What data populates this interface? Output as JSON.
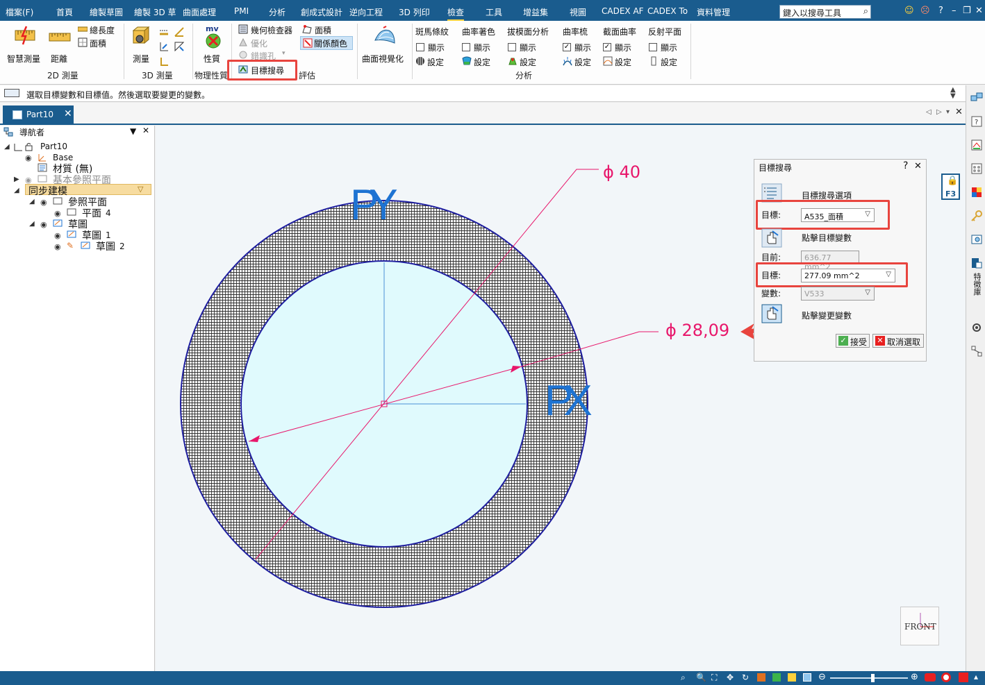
{
  "menu": {
    "items": [
      "檔案(F)",
      "首頁",
      "繪製草圖",
      "繪製 3D 草",
      "曲面處理",
      "PMI",
      "分析",
      "創成式設計",
      "逆向工程",
      "3D 列印",
      "檢查",
      "工具",
      "增益集",
      "視圖",
      "CADEX AF",
      "CADEX To",
      "資料管理"
    ],
    "active_index": 10,
    "search_placeholder": "鍵入以搜尋工具",
    "window_controls": [
      "?",
      "–",
      "❐",
      "✕"
    ]
  },
  "ribbon": {
    "measure2d": {
      "smart": "智慧測量",
      "distance": "距離",
      "total_length": "總長度",
      "area": "面積",
      "group": "2D 測量"
    },
    "measure3d": {
      "measure": "測量",
      "group": "3D 測量"
    },
    "physical": {
      "mv": "mv",
      "props": "性質",
      "group": "物理性質"
    },
    "evaluate": {
      "geom_checker": "幾何檢查器",
      "optimize": "優化",
      "error_id": "錯識孔",
      "area": "面積",
      "relation_color": "關係顏色",
      "goal_seek": "目標搜尋",
      "group_suffix": "評估"
    },
    "surface_vis": {
      "label": "曲面視覺化"
    },
    "analysis": {
      "zebra": "斑馬條紋",
      "curvature_shade": "曲率著色",
      "draft": "拔模面分析",
      "curvature_comb": "曲率梳",
      "section_curv": "截面曲率",
      "reflective": "反射平面",
      "show": "顯示",
      "settings": "設定",
      "group": "分析"
    }
  },
  "prompt": {
    "text": "選取目標變數和目標值。然後選取要變更的變數。"
  },
  "tab": {
    "name": "Part10",
    "close": "✕"
  },
  "navigator": {
    "title": "導航者",
    "items": {
      "part": "Part10",
      "base": "Base",
      "material": "材質 (無)",
      "base_planes": "基本參照平面",
      "sync": "同步建模",
      "ref_planes": "參照平面",
      "plane": "平面",
      "plane_num": "4",
      "sketch_group": "草圖",
      "sketch": "草圖",
      "sketch1_num": "1",
      "sketch2_num": "2"
    }
  },
  "canvas": {
    "dim_outer": "ϕ 40",
    "dim_inner": "ϕ 28,09",
    "axis_y": "PY",
    "axis_x": "PX",
    "view": "FRONT"
  },
  "dialog": {
    "title": "目標搜尋",
    "help": "?",
    "close": "✕",
    "options": "目標搜尋選項",
    "target_label": "目標:",
    "target_value": "A535_面積",
    "click_target": "點擊目標變數",
    "current_label": "目前:",
    "current_value": "636.77 mm^2",
    "goal_label": "目標:",
    "goal_value": "277.09 mm^2",
    "variable_label": "變數:",
    "variable_value": "V533",
    "click_change": "點擊變更變數",
    "accept": "接受",
    "cancel": "取消選取"
  },
  "rail": {
    "vertical_label": "特徵庫",
    "f3": "F3"
  },
  "colors": {
    "accent": "#1a5c8e",
    "highlight": "#e8443e",
    "dimension": "#e8176b",
    "circle": "#1f1fa0",
    "fill": "#e0fafd",
    "axis": "#1e73d2"
  }
}
